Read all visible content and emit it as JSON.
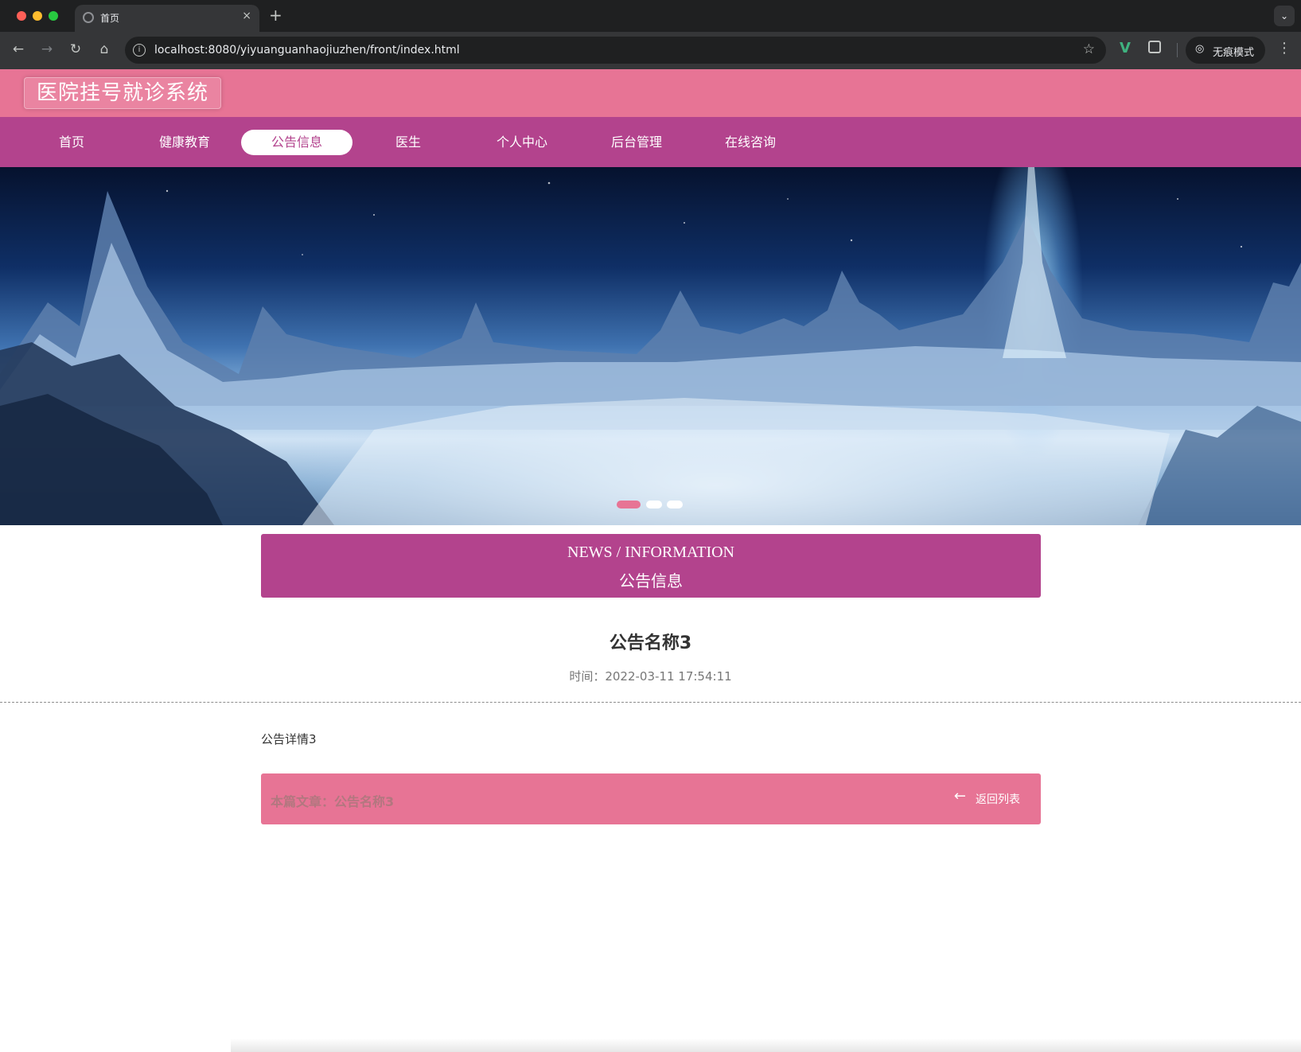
{
  "browser": {
    "tab_title": "首页",
    "tab_close": "×",
    "new_tab": "+",
    "tab_menu": "⌄",
    "back": "←",
    "forward": "→",
    "reload": "↻",
    "home": "⌂",
    "site_info": "i",
    "url": "localhost:8080/yiyuanguanhaojiuzhen/front/index.html",
    "bookmark": "☆",
    "extension_v": "V",
    "incognito_icon": "◎",
    "incognito_label": "无痕模式",
    "menu": "⋮"
  },
  "site": {
    "title": "医院挂号就诊系统"
  },
  "nav": {
    "active": "公告信息",
    "items": [
      {
        "label": "首页"
      },
      {
        "label": "健康教育"
      },
      {
        "label": "公告信息"
      },
      {
        "label": "医生"
      },
      {
        "label": "个人中心"
      },
      {
        "label": "后台管理"
      },
      {
        "label": "在线咨询"
      }
    ]
  },
  "carousel": {
    "slide_count": 3,
    "active_index": 0
  },
  "section": {
    "title_en": "NEWS / INFORMATION",
    "title_cn": "公告信息"
  },
  "article": {
    "title": "公告名称3",
    "time_label": "时间：",
    "time_value": "2022-03-11 17:54:11",
    "body": "公告详情3"
  },
  "footer": {
    "current_label": "本篇文章：公告名称3",
    "back_arrow": "←",
    "back_label": "返回列表"
  },
  "colors": {
    "header_pink": "#e77495",
    "nav_magenta": "#b3438d"
  }
}
